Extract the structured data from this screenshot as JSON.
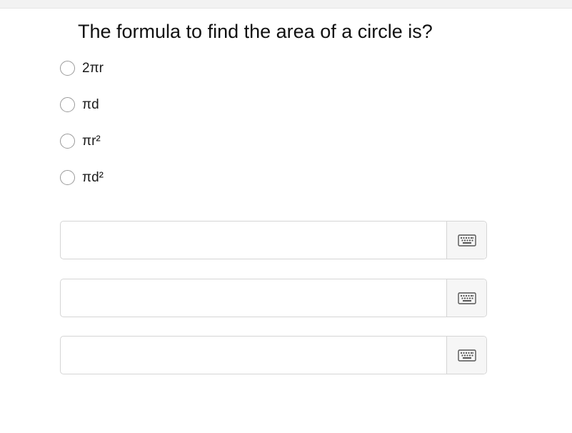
{
  "question": {
    "text": "The formula to find the area of a circle is?"
  },
  "options": [
    {
      "label": "2πr"
    },
    {
      "label": "πd"
    },
    {
      "label": "πr²"
    },
    {
      "label": "πd²"
    }
  ],
  "answer_fields": [
    {
      "value": "",
      "keyboard_icon": "keyboard-icon"
    },
    {
      "value": "",
      "keyboard_icon": "keyboard-icon"
    },
    {
      "value": "",
      "keyboard_icon": "keyboard-icon"
    }
  ],
  "colors": {
    "border": "#d5d5d5",
    "keyboard_button_bg": "#f6f6f6",
    "radio_border": "#9a9a9a",
    "text": "#1a1a1a"
  }
}
